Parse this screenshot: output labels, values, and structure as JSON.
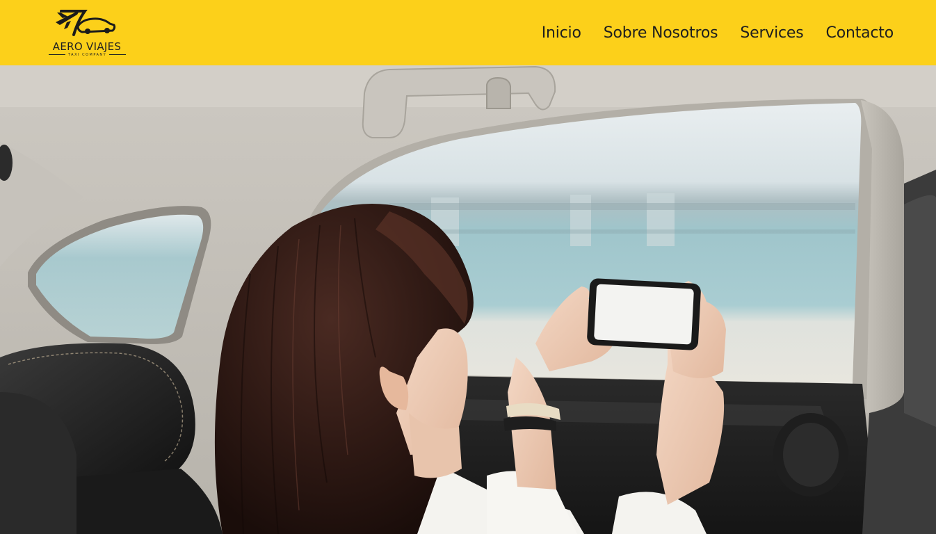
{
  "header": {
    "brand": {
      "name": "AERO VIAJES",
      "tagline": "TAXI COMPANY",
      "icon": "plane-car-logo-icon"
    },
    "nav": [
      {
        "label": "Inicio"
      },
      {
        "label": "Sobre Nosotros"
      },
      {
        "label": "Services"
      },
      {
        "label": "Contacto"
      }
    ],
    "background_color": "#FCD01A"
  },
  "hero": {
    "image": "woman-photographing-through-taxi-window"
  }
}
